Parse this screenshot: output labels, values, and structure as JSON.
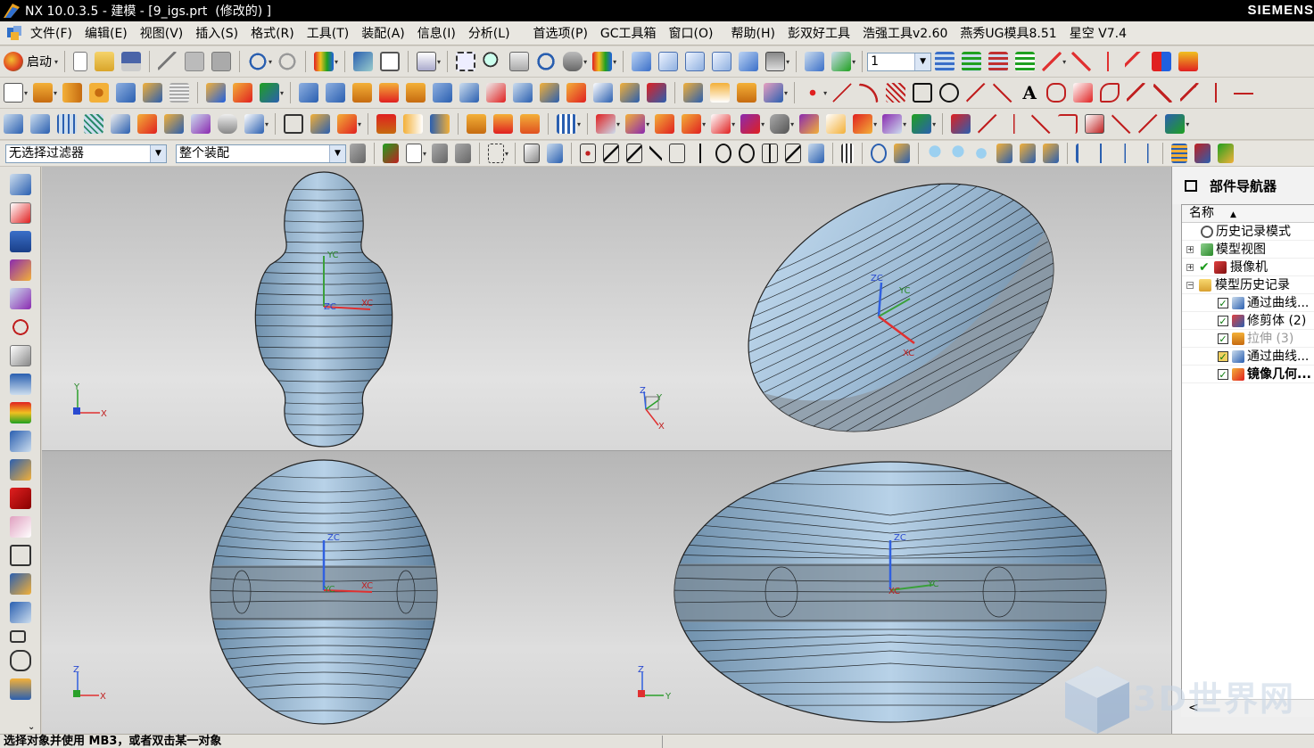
{
  "window": {
    "title": "NX 10.0.3.5 - 建模 - [9_igs.prt  (修改的) ]",
    "brand": "SIEMENS"
  },
  "menu": [
    "文件(F)",
    "编辑(E)",
    "视图(V)",
    "插入(S)",
    "格式(R)",
    "工具(T)",
    "装配(A)",
    "信息(I)",
    "分析(L)",
    "首选项(P)",
    "GC工具箱",
    "窗口(O)",
    "帮助(H)",
    "彭双好工具",
    "浩强工具v2.60",
    "燕秀UG模具8.51",
    "星空 V7.4"
  ],
  "toolbar": {
    "start_label": "启动",
    "layer_value": "1",
    "filter_value": "无选择过滤器",
    "scope_value": "整个装配"
  },
  "colors": {
    "accent": "#0a5bc4",
    "model_blue": "#9cbad4",
    "axis_x": "#e03030",
    "axis_y": "#2aa02a",
    "axis_z": "#3060e0"
  },
  "viewports": {
    "top_left": {
      "axis_labels": [
        "YC",
        "ZC",
        "XC"
      ],
      "triad_labels": [
        "Y",
        "X"
      ]
    },
    "top_right": {
      "axis_labels": [
        "ZC",
        "YC",
        "XC"
      ],
      "triad_labels": [
        "Z",
        "Y",
        "X"
      ]
    },
    "bottom_left": {
      "axis_labels": [
        "ZC",
        "YC",
        "XC"
      ],
      "triad_labels": [
        "Z",
        "X"
      ]
    },
    "bottom_right": {
      "axis_labels": [
        "ZC",
        "XC",
        "YC"
      ],
      "triad_labels": [
        "Z",
        "Y"
      ]
    }
  },
  "navigator": {
    "title": "部件导航器",
    "column": "名称",
    "items": [
      {
        "label": "历史记录模式",
        "icon": "clock-icon"
      },
      {
        "label": "模型视图",
        "icon": "model-views-icon"
      },
      {
        "label": "摄像机",
        "icon": "camera-icon"
      },
      {
        "label": "模型历史记录",
        "icon": "folder-icon"
      },
      {
        "label": "通过曲线...",
        "icon": "through-curves-icon"
      },
      {
        "label": "修剪体 (2)",
        "icon": "trim-body-icon"
      },
      {
        "label": "拉伸 (3)",
        "icon": "extrude-icon"
      },
      {
        "label": "通过曲线...",
        "icon": "through-curves-icon"
      },
      {
        "label": "镜像几何...",
        "icon": "mirror-geometry-icon"
      }
    ],
    "scroll_left": "<"
  },
  "status": {
    "message": "选择对象并使用 MB3，或者双击某一对象"
  },
  "watermark": {
    "text": "3D世界网"
  }
}
